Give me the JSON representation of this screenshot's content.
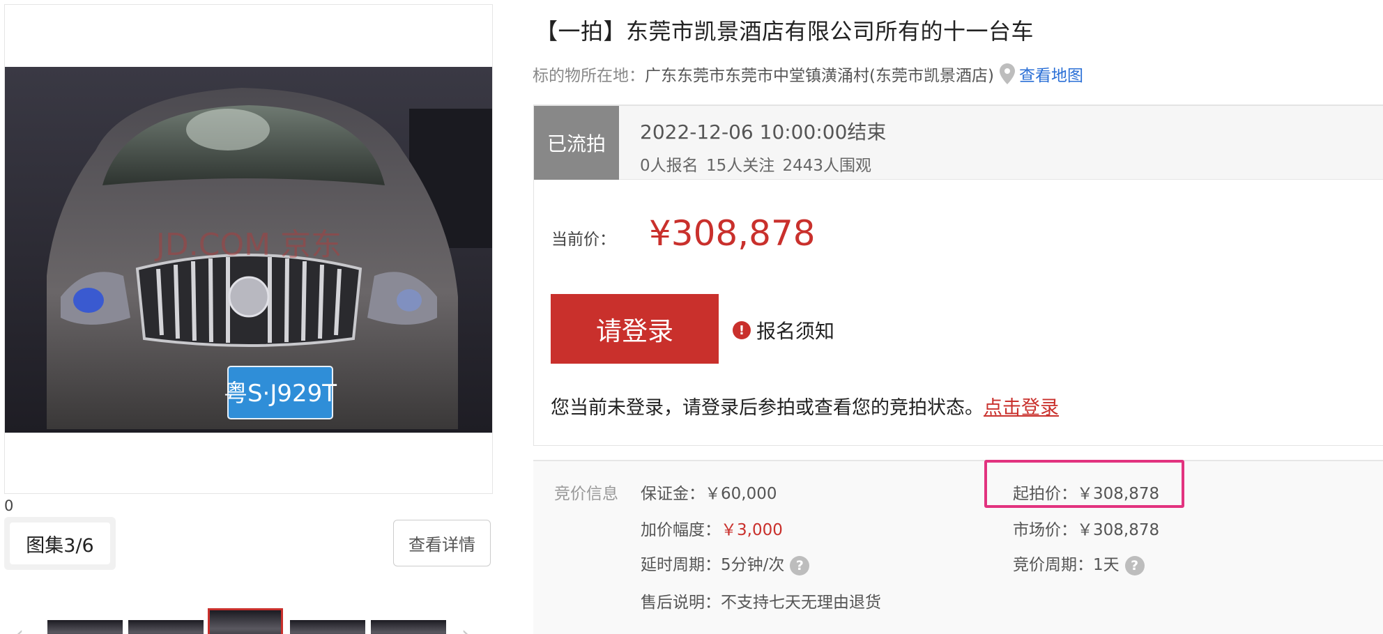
{
  "gallery": {
    "counter_zero": "0",
    "album_label": "图集3/6",
    "detail_button": "查看详情",
    "photo_plate_text": "粤S·J929T",
    "photo_watermark": "JD.COM 京东"
  },
  "item": {
    "title": "【一拍】东莞市凯景酒店有限公司所有的十一台车",
    "location_label": "标的物所在地：",
    "location_value": "广东东莞市东莞市中堂镇潢涌村(东莞市凯景酒店)",
    "map_link": "查看地图"
  },
  "status": {
    "tag": "已流拍",
    "end_time": "2022-12-06 10:00:00结束",
    "stats": "0人报名  15人关注  2443人围观",
    "price_label": "当前价：",
    "price_value": "¥308,878",
    "login_button": "请登录",
    "notice_link": "报名须知",
    "login_hint": "您当前未登录，请登录后参拍或查看您的竞拍状态。",
    "login_hint_link": "点击登录"
  },
  "bid_info": {
    "section_label": "竞价信息",
    "deposit_label": "保证金：",
    "deposit_value": "￥60,000",
    "increment_label": "加价幅度：",
    "increment_value": "￥3,000",
    "delay_label": "延时周期：",
    "delay_value": "5分钟/次",
    "aftersale_label": "售后说明：",
    "aftersale_value": "不支持七天无理由退货",
    "start_price_label": "起拍价：",
    "start_price_value": "￥308,878",
    "market_price_label": "市场价：",
    "market_price_value": "￥308,878",
    "bid_period_label": "竞价周期：",
    "bid_period_value": "1天"
  },
  "colors": {
    "accent_red": "#c9302c",
    "link_blue": "#2a6fd6",
    "highlight_pink": "#e2337f",
    "status_gray": "#888888"
  },
  "icons": [
    "location-pin-icon",
    "alert-icon",
    "help-icon",
    "chevron-left-icon",
    "chevron-right-icon"
  ]
}
